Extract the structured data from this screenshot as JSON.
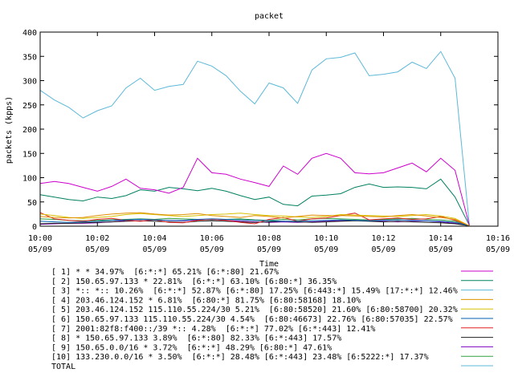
{
  "chart_data": {
    "type": "line",
    "title": "packet",
    "xlabel": "Time",
    "ylabel": "packets (kpps)",
    "ylim": [
      0,
      400
    ],
    "xlim": [
      "10:00",
      "10:16"
    ],
    "y_ticks": [
      "0",
      "50",
      "100",
      "150",
      "200",
      "250",
      "300",
      "350",
      "400"
    ],
    "x_ticks": [
      {
        "time": "10:00",
        "date": "05/09"
      },
      {
        "time": "10:02",
        "date": "05/09"
      },
      {
        "time": "10:04",
        "date": "05/09"
      },
      {
        "time": "10:06",
        "date": "05/09"
      },
      {
        "time": "10:08",
        "date": "05/09"
      },
      {
        "time": "10:10",
        "date": "05/09"
      },
      {
        "time": "10:12",
        "date": "05/09"
      },
      {
        "time": "10:14",
        "date": "05/09"
      },
      {
        "time": "10:16",
        "date": "05/09"
      }
    ],
    "x": [
      "10:00:00",
      "10:00:30",
      "10:01:00",
      "10:01:30",
      "10:02:00",
      "10:02:30",
      "10:03:00",
      "10:03:30",
      "10:04:00",
      "10:04:30",
      "10:05:00",
      "10:05:30",
      "10:06:00",
      "10:06:30",
      "10:07:00",
      "10:07:30",
      "10:08:00",
      "10:08:30",
      "10:09:00",
      "10:09:30",
      "10:10:00",
      "10:10:30",
      "10:11:00",
      "10:11:30",
      "10:12:00",
      "10:12:30",
      "10:13:00",
      "10:13:30",
      "10:14:00",
      "10:14:30",
      "10:15:00"
    ],
    "grid": false,
    "legend_position": "bottom",
    "series": [
      {
        "name": "[ 1] * * 34.97%  [6:*:*] 65.21% [6:*:80] 21.67%",
        "color": "#cc00cc",
        "values": [
          88,
          92,
          88,
          80,
          72,
          82,
          97,
          78,
          75,
          68,
          80,
          140,
          110,
          107,
          97,
          90,
          82,
          124,
          107,
          140,
          150,
          140,
          110,
          108,
          110,
          120,
          130,
          112,
          140,
          115,
          2
        ]
      },
      {
        "name": "[ 2] 150.65.97.133 * 22.81%  [6:*:*] 63.10% [6:80:*] 36.35%",
        "color": "#008060",
        "values": [
          65,
          60,
          55,
          52,
          60,
          57,
          63,
          75,
          72,
          80,
          77,
          73,
          78,
          72,
          63,
          55,
          60,
          45,
          42,
          62,
          64,
          67,
          80,
          87,
          80,
          81,
          80,
          77,
          97,
          60,
          2
        ]
      },
      {
        "name": "[ 3] *:: *:: 10.26%  [6:*:*] 52.87% [6:*:80] 17.25% [6:443:*] 15.49% [17:*:*] 12.46%",
        "color": "#5cb8d8",
        "values": [
          280,
          260,
          245,
          223,
          238,
          248,
          285,
          305,
          280,
          288,
          292,
          340,
          330,
          310,
          278,
          252,
          295,
          285,
          253,
          322,
          345,
          348,
          357,
          310,
          313,
          318,
          338,
          325,
          360,
          305,
          2
        ]
      },
      {
        "name": "[ 4] 203.46.124.152 * 6.81%  [6:80:*] 81.75% [6:80:58168] 18.10%",
        "color": "#e09000",
        "values": [
          20,
          18,
          17,
          18,
          22,
          25,
          27,
          28,
          25,
          23,
          24,
          26,
          22,
          20,
          18,
          22,
          20,
          17,
          20,
          23,
          22,
          22,
          21,
          20,
          19,
          22,
          24,
          21,
          18,
          14,
          1
        ]
      },
      {
        "name": "[ 5] 203.46.124.152 115.110.55.224/30 5.21%  [6:80:58520] 21.60% [6:80:58700] 20.32%",
        "color": "#d8c000",
        "values": [
          25,
          22,
          18,
          16,
          18,
          20,
          24,
          26,
          24,
          22,
          20,
          22,
          24,
          25,
          27,
          24,
          22,
          21,
          19,
          18,
          20,
          24,
          23,
          22,
          21,
          20,
          22,
          24,
          21,
          16,
          1
        ]
      },
      {
        "name": "[ 6] 150.65.97.133 115.110.55.224/30 4.54%  [6:80:46673] 22.76% [6:80:57035] 22.57%",
        "color": "#0060b0",
        "values": [
          10,
          9,
          8,
          9,
          10,
          12,
          13,
          14,
          13,
          12,
          12,
          14,
          15,
          14,
          13,
          12,
          11,
          10,
          10,
          11,
          12,
          13,
          12,
          11,
          12,
          13,
          12,
          11,
          10,
          8,
          1
        ]
      },
      {
        "name": "[ 7] 2001:82f8:f400::/39 *:: 4.28%  [6:*:*] 77.02% [6:*:443] 12.41%",
        "color": "#e02020",
        "values": [
          28,
          15,
          12,
          10,
          14,
          16,
          12,
          10,
          13,
          8,
          7,
          12,
          14,
          12,
          8,
          5,
          14,
          18,
          10,
          15,
          17,
          22,
          27,
          13,
          15,
          17,
          14,
          15,
          20,
          12,
          1
        ]
      },
      {
        "name": "[ 8] * 150.65.97.133 3.89%  [6:*:80] 82.33% [6:*:443] 17.57%",
        "color": "#202020",
        "values": [
          5,
          6,
          6,
          7,
          8,
          9,
          10,
          11,
          10,
          9,
          8,
          10,
          11,
          10,
          9,
          8,
          9,
          10,
          9,
          8,
          9,
          10,
          11,
          10,
          9,
          10,
          9,
          8,
          7,
          5,
          1
        ]
      },
      {
        "name": "[ 9] 150.65.0.0/16 * 3.72%  [6:*:*] 48.29% [6:80:*] 47.61%",
        "color": "#8000c0",
        "values": [
          4,
          5,
          6,
          6,
          7,
          9,
          12,
          14,
          13,
          12,
          11,
          13,
          14,
          12,
          10,
          9,
          8,
          9,
          8,
          9,
          10,
          11,
          12,
          11,
          10,
          9,
          10,
          11,
          9,
          6,
          1
        ]
      },
      {
        "name": "[10] 133.230.0.0/16 * 3.50%  [6:*:*] 28.48% [6:*:443] 23.48% [6:5222:*] 17.37%",
        "color": "#30a040",
        "values": [
          15,
          14,
          12,
          11,
          12,
          13,
          14,
          15,
          14,
          16,
          15,
          14,
          13,
          14,
          15,
          13,
          12,
          14,
          13,
          15,
          16,
          15,
          14,
          13,
          14,
          15,
          16,
          14,
          13,
          10,
          1
        ]
      },
      {
        "name": "TOTAL",
        "color": "#5cb8d8",
        "values": null
      }
    ]
  }
}
